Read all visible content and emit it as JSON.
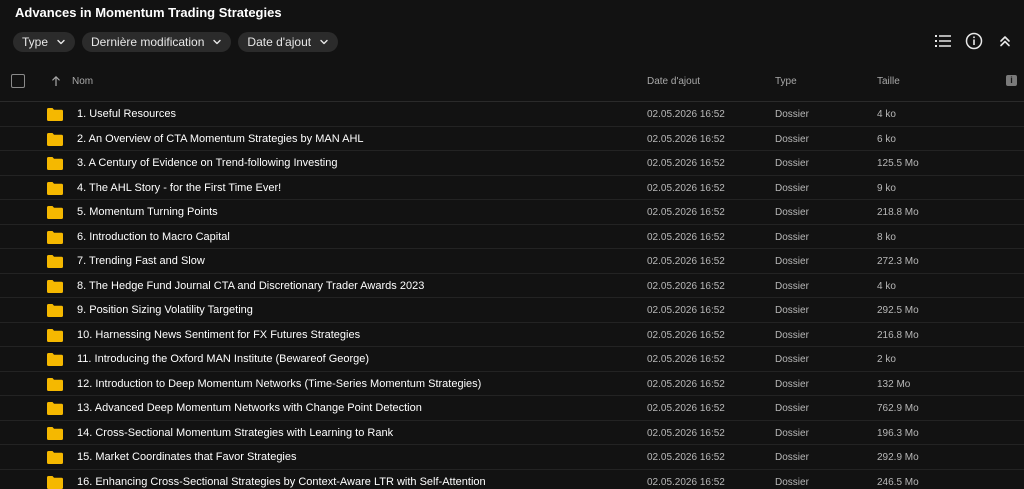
{
  "title": "Advances in Momentum Trading Strategies",
  "filters": [
    {
      "label": "Type"
    },
    {
      "label": "Dernière modification"
    },
    {
      "label": "Date d'ajout"
    }
  ],
  "toolbar": {
    "icons": [
      "list-view-icon",
      "info-icon",
      "collapse-icon"
    ]
  },
  "table": {
    "headers": {
      "name": "Nom",
      "date": "Date d'ajout",
      "type": "Type",
      "size": "Taille"
    },
    "rows": [
      {
        "name": "1. Useful Resources",
        "date": "02.05.2026 16:52",
        "type": "Dossier",
        "size": "4 ko"
      },
      {
        "name": "2. An Overview of CTA Momentum Strategies by MAN AHL",
        "date": "02.05.2026 16:52",
        "type": "Dossier",
        "size": "6 ko"
      },
      {
        "name": "3. A Century of Evidence on Trend-following Investing",
        "date": "02.05.2026 16:52",
        "type": "Dossier",
        "size": "125.5 Mo"
      },
      {
        "name": "4. The AHL Story - for the First Time Ever!",
        "date": "02.05.2026 16:52",
        "type": "Dossier",
        "size": "9 ko"
      },
      {
        "name": "5. Momentum Turning Points",
        "date": "02.05.2026 16:52",
        "type": "Dossier",
        "size": "218.8 Mo"
      },
      {
        "name": "6. Introduction to Macro Capital",
        "date": "02.05.2026 16:52",
        "type": "Dossier",
        "size": "8 ko"
      },
      {
        "name": "7. Trending Fast and Slow",
        "date": "02.05.2026 16:52",
        "type": "Dossier",
        "size": "272.3 Mo"
      },
      {
        "name": "8. The Hedge Fund Journal CTA and Discretionary Trader Awards 2023",
        "date": "02.05.2026 16:52",
        "type": "Dossier",
        "size": "4 ko"
      },
      {
        "name": "9. Position Sizing Volatility Targeting",
        "date": "02.05.2026 16:52",
        "type": "Dossier",
        "size": "292.5 Mo"
      },
      {
        "name": "10. Harnessing News Sentiment for FX Futures Strategies",
        "date": "02.05.2026 16:52",
        "type": "Dossier",
        "size": "216.8 Mo"
      },
      {
        "name": "11. Introducing the Oxford MAN Institute (Bewareof George)",
        "date": "02.05.2026 16:52",
        "type": "Dossier",
        "size": "2 ko"
      },
      {
        "name": "12. Introduction to Deep Momentum Networks (Time-Series Momentum Strategies)",
        "date": "02.05.2026 16:52",
        "type": "Dossier",
        "size": "132 Mo"
      },
      {
        "name": "13. Advanced Deep Momentum Networks with Change Point Detection",
        "date": "02.05.2026 16:52",
        "type": "Dossier",
        "size": "762.9 Mo"
      },
      {
        "name": "14. Cross-Sectional Momentum Strategies with Learning to Rank",
        "date": "02.05.2026 16:52",
        "type": "Dossier",
        "size": "196.3 Mo"
      },
      {
        "name": "15. Market Coordinates that Favor Strategies",
        "date": "02.05.2026 16:52",
        "type": "Dossier",
        "size": "292.9 Mo"
      },
      {
        "name": "16. Enhancing Cross-Sectional Strategies by Context-Aware LTR with Self-Attention",
        "date": "02.05.2026 16:52",
        "type": "Dossier",
        "size": "246.5 Mo"
      }
    ]
  },
  "colors": {
    "background": "#121212",
    "chip": "#2b2b2b",
    "folder": "#f5b800",
    "text": "#ffffff",
    "muted": "#b8b8b8"
  }
}
